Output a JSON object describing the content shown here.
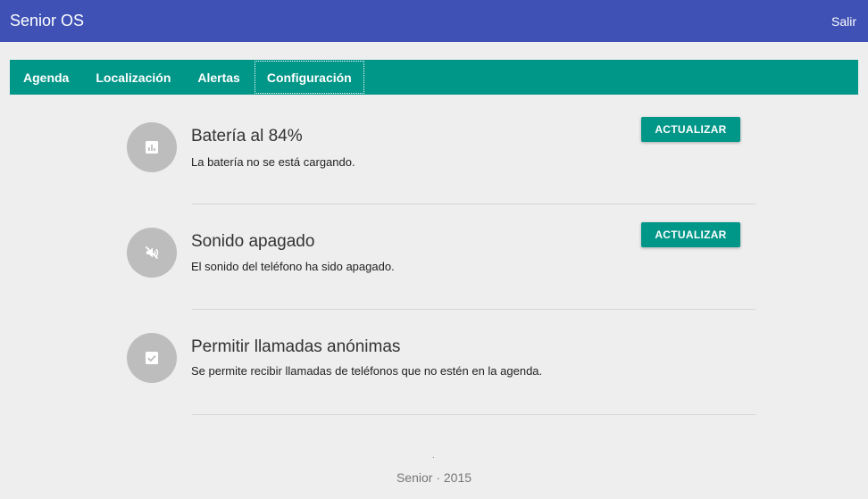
{
  "header": {
    "title": "Senior OS",
    "logout_label": "Salir"
  },
  "tabs": [
    {
      "label": "Agenda"
    },
    {
      "label": "Localización"
    },
    {
      "label": "Alertas"
    },
    {
      "label": "Configuración",
      "active": true
    }
  ],
  "settings": [
    {
      "icon": "battery-chart-icon",
      "title": "Batería al 84%",
      "description": "La batería no se está cargando.",
      "button_label": "ACTUALIZAR"
    },
    {
      "icon": "volume-off-icon",
      "title": "Sonido apagado",
      "description": "El sonido del teléfono ha sido apagado.",
      "button_label": "ACTUALIZAR"
    },
    {
      "icon": "checkbox-checked-icon",
      "title": "Permitir llamadas anónimas",
      "description": "Se permite recibir llamadas de teléfonos que no estén en la agenda."
    }
  ],
  "footer": {
    "dot": ".",
    "text": "Senior · 2015"
  },
  "colors": {
    "header": "#3f51b5",
    "accent": "#009688",
    "icon_circle": "#bdbdbd",
    "background": "#eeeeee"
  }
}
